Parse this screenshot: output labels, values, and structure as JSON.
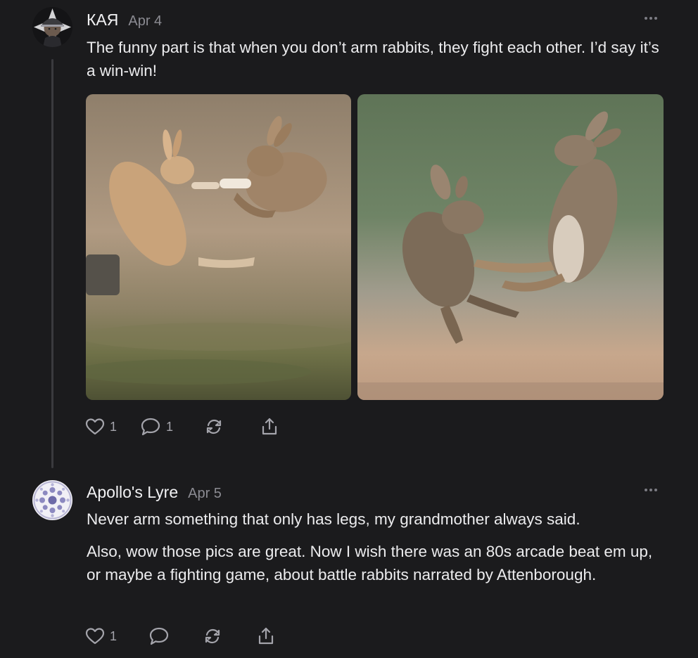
{
  "posts": [
    {
      "author": "КАЯ",
      "date": "Apr 4",
      "text": [
        "The funny part is that when you don’t arm rabbits, they fight each other. I’d say it’s a win-win!"
      ],
      "actions": {
        "likes": "1",
        "comments": "1"
      },
      "icons": [
        "heart-icon",
        "comment-icon",
        "repost-icon",
        "share-icon",
        "more-icon"
      ]
    },
    {
      "author": "Apollo's Lyre",
      "date": "Apr 5",
      "text": [
        "Never arm something that only has legs, my grandmother always said.",
        "Also, wow those pics are great. Now I wish there was an 80s arcade beat em up, or maybe a fighting game, about battle rabbits narrated by Attenborough."
      ],
      "actions": {
        "likes": "1",
        "comments": ""
      },
      "icons": [
        "heart-icon",
        "comment-icon",
        "repost-icon",
        "share-icon",
        "more-icon"
      ]
    }
  ],
  "colors": {
    "background": "#1b1b1d",
    "text": "#ececee",
    "muted": "#8b8b92",
    "icon": "#a4a4ab"
  }
}
